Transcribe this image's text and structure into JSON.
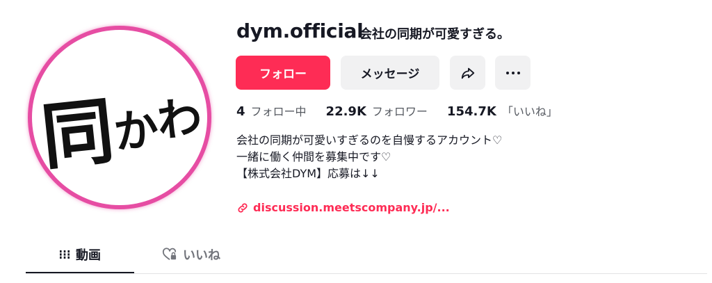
{
  "profile": {
    "username": "dym.official",
    "nickname": "会社の同期が可愛すぎる。",
    "avatar_text": "同かわ",
    "avatar_ring_color": "#e64da3"
  },
  "actions": {
    "follow_label": "フォロー",
    "message_label": "メッセージ",
    "share_icon": "share-arrow-icon",
    "more_icon": "more-dots-icon"
  },
  "stats": [
    {
      "value": "4",
      "label": "フォロー中"
    },
    {
      "value": "22.9K",
      "label": "フォロワー"
    },
    {
      "value": "154.7K",
      "label": "「いいね」"
    }
  ],
  "bio": [
    "会社の同期が可愛いすぎるのを自慢するアカウント♡",
    "一緒に働く仲間を募集中です♡",
    "【株式会社DYM】応募は↓↓"
  ],
  "link": {
    "text": "discussion.meetscompany.jp/...",
    "icon": "link-icon"
  },
  "tabs": [
    {
      "label": "動画",
      "icon": "grid-icon",
      "active": true
    },
    {
      "label": "いいね",
      "icon": "heart-lock-icon",
      "active": false
    }
  ],
  "colors": {
    "accent": "#fe2c55",
    "secondary_button": "#f1f1f2",
    "text": "#161823",
    "muted": "#73757c"
  }
}
